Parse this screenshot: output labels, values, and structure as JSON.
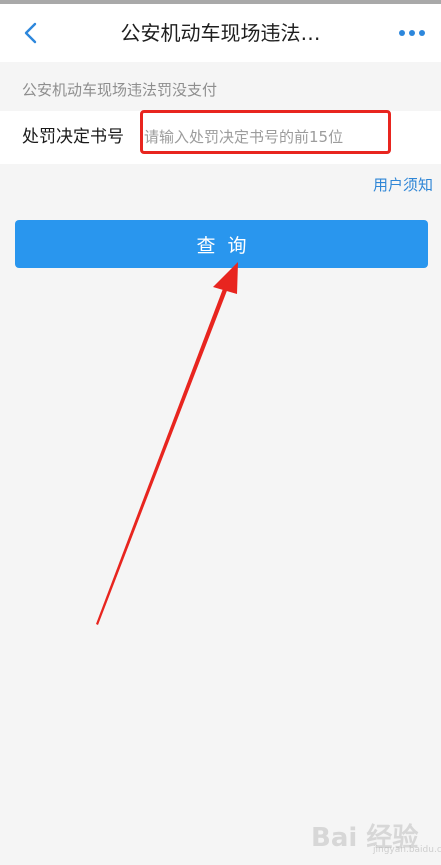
{
  "navbar": {
    "title": "公安机动车现场违法…",
    "back_icon": "chevron-left-icon",
    "more_icon": "more-dots-icon"
  },
  "section": {
    "label": "公安机动车现场违法罚没支付"
  },
  "form": {
    "field_label": "处罚决定书号",
    "value": "",
    "placeholder": "请输入处罚决定书号的前15位"
  },
  "links": {
    "notice": "用户须知"
  },
  "actions": {
    "query_label": "查询"
  },
  "watermark": {
    "text": "Bai 经验",
    "sub": "jingyan.baidu.com"
  },
  "colors": {
    "accent": "#2996ee",
    "link": "#2f86d6",
    "annotation": "#e8251f"
  }
}
